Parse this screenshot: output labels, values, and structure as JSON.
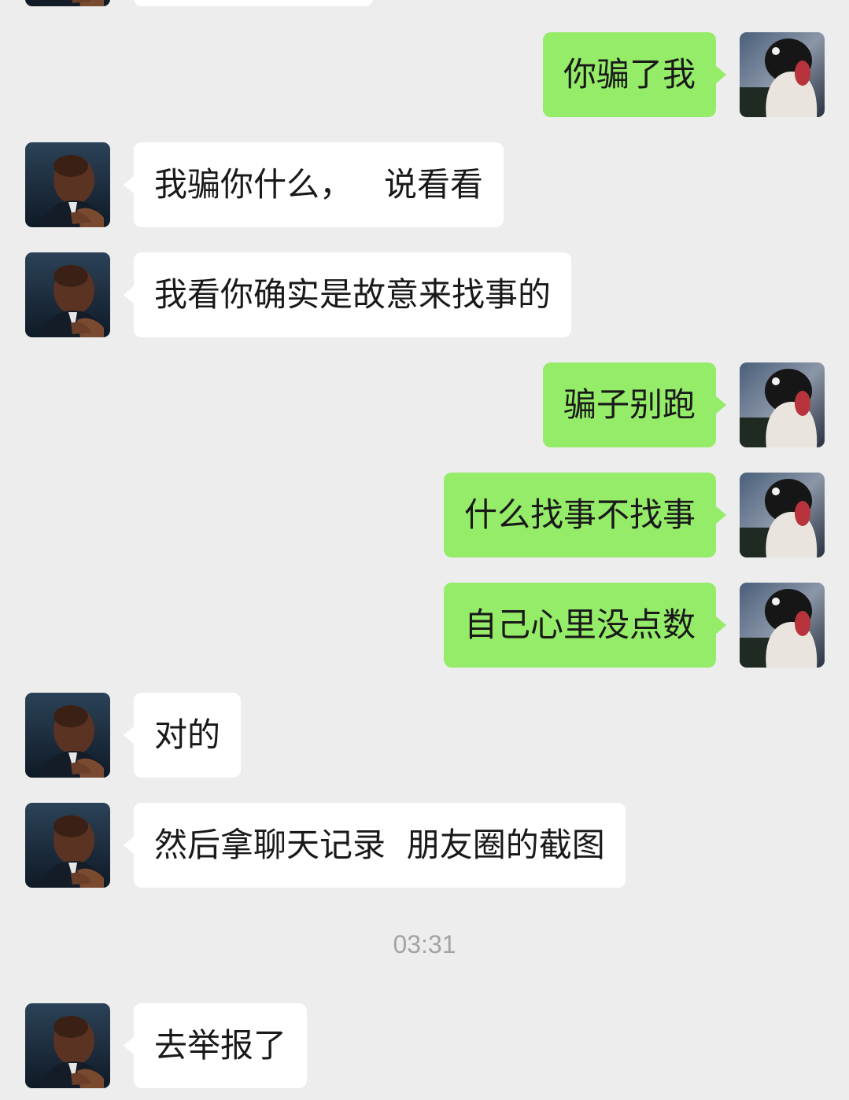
{
  "messages": [
    {
      "side": "right",
      "text": "你骗了我"
    },
    {
      "side": "left",
      "text": "我骗你什么，   说看看"
    },
    {
      "side": "left",
      "text": "我看你确实是故意来找事的"
    },
    {
      "side": "right",
      "text": "骗子别跑"
    },
    {
      "side": "right",
      "text": "什么找事不找事"
    },
    {
      "side": "right",
      "text": "自己心里没点数"
    },
    {
      "side": "left",
      "text": "对的"
    },
    {
      "side": "left",
      "text": "然后拿聊天记录  朋友圈的截图"
    },
    {
      "side": "left",
      "text": "去举报了"
    }
  ],
  "timestamp": "03:31",
  "colors": {
    "background": "#ededed",
    "sent_bubble": "#95ec69",
    "received_bubble": "#ffffff",
    "timestamp_text": "#a3a3a3"
  },
  "icons": {
    "contact_avatar": "contact-avatar-icon",
    "self_avatar": "self-avatar-icon"
  }
}
